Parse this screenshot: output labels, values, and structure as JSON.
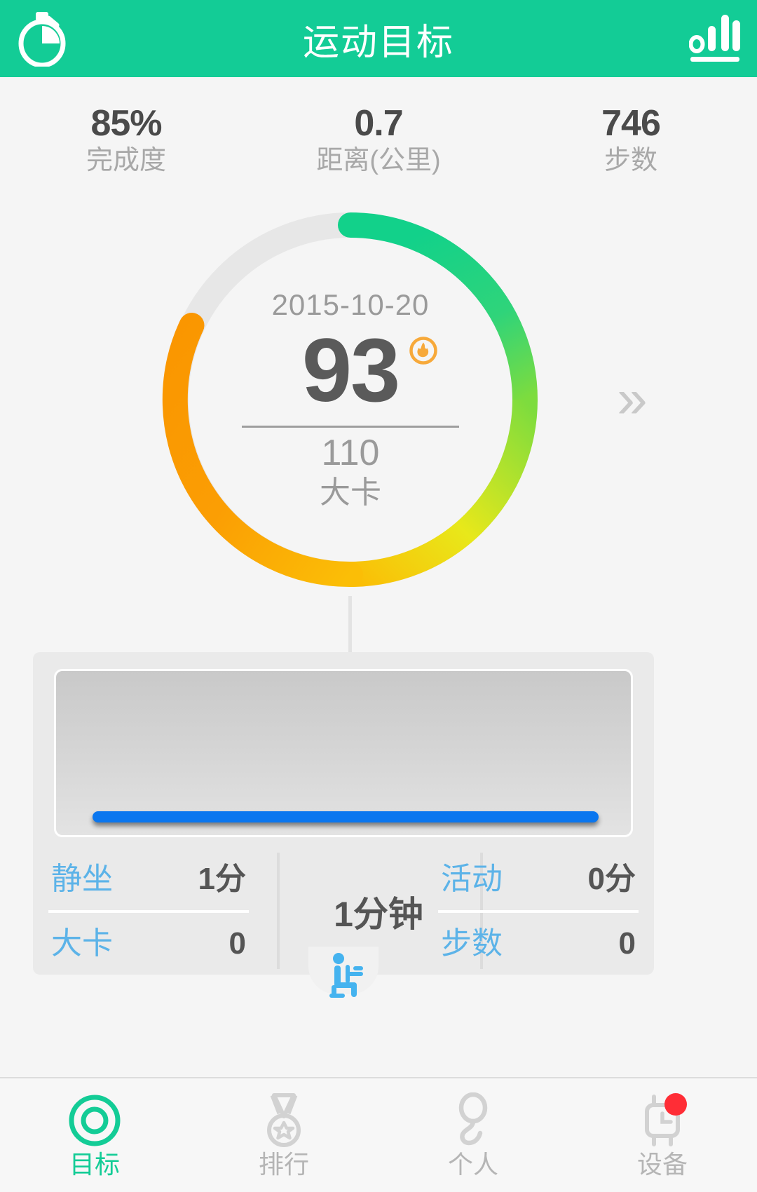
{
  "header": {
    "title": "运动目标",
    "left_icon": "stopwatch-icon",
    "right_icon": "bar-chart-icon",
    "bg_color": "#13cc96"
  },
  "top_stats": [
    {
      "value": "85%",
      "label": "完成度"
    },
    {
      "value": "0.7",
      "label": "距离(公里)"
    },
    {
      "value": "746",
      "label": "步数"
    }
  ],
  "ring": {
    "date": "2015-10-20",
    "current": "93",
    "goal": "110",
    "unit": "大卡",
    "percent": 85,
    "badge_icon": "flame-icon",
    "track_color": "#e6e6e6",
    "gradient_start": "#12d18a",
    "gradient_mid": "#e8e81a",
    "gradient_end": "#fa9600",
    "next_arrow": "»"
  },
  "card": {
    "progress_bar_color": "#0a76ef",
    "progress_percent": 100,
    "center_duration": "1分钟",
    "left_rows": [
      {
        "label": "静坐",
        "value": "1分"
      },
      {
        "label": "大卡",
        "value": "0"
      }
    ],
    "right_rows": [
      {
        "label": "活动",
        "value": "0分"
      },
      {
        "label": "步数",
        "value": "0"
      }
    ],
    "tab_icon": "sitting-person-icon",
    "label_color": "#5cb3e8"
  },
  "bottom_nav": {
    "active_color": "#13cc96",
    "inactive_color": "#b5b5b5",
    "items": [
      {
        "label": "目标",
        "icon": "target-ring-icon",
        "active": true,
        "badge": false
      },
      {
        "label": "排行",
        "icon": "medal-icon",
        "active": false,
        "badge": false
      },
      {
        "label": "个人",
        "icon": "person-icon",
        "active": false,
        "badge": false
      },
      {
        "label": "设备",
        "icon": "watch-device-icon",
        "active": false,
        "badge": true
      }
    ]
  }
}
